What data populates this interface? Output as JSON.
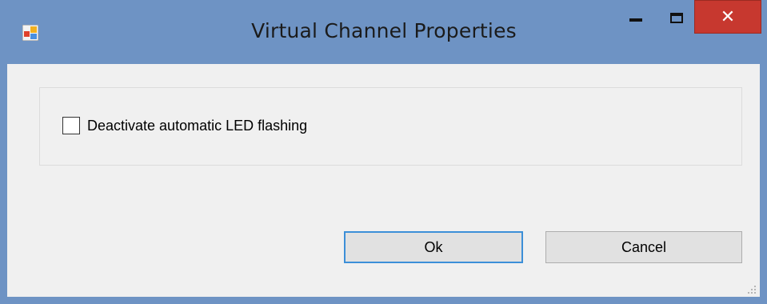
{
  "window": {
    "title": "Virtual Channel Properties",
    "icon": "app-form-icon",
    "controls": {
      "minimize": "minimize-icon",
      "maximize": "maximize-icon",
      "close_glyph": "✕"
    }
  },
  "options": {
    "deactivate_led_label": "Deactivate automatic LED flashing",
    "deactivate_led_checked": false
  },
  "buttons": {
    "ok_label": "Ok",
    "cancel_label": "Cancel"
  },
  "colors": {
    "frame": "#6e93c4",
    "close": "#c7382f",
    "focus": "#3c8fd8"
  }
}
